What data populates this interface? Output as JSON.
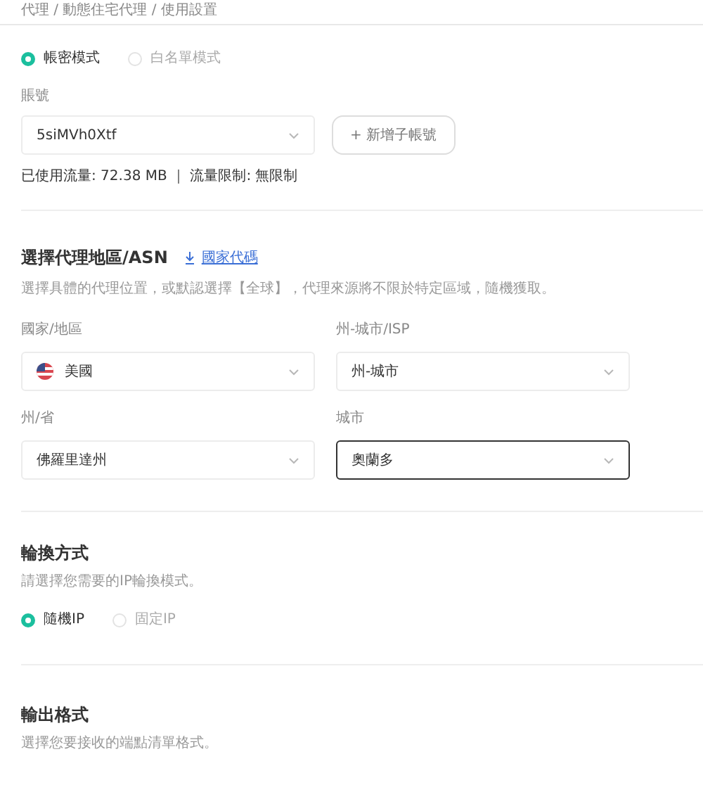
{
  "breadcrumb": "代理 / 動態住宅代理 / 使用設置",
  "auth_modes": [
    {
      "label": "帳密模式",
      "selected": true
    },
    {
      "label": "白名單模式",
      "selected": false
    }
  ],
  "account": {
    "label": "賬號",
    "value": "5siMVh0Xtf",
    "add_button": "+ 新增子帳號",
    "usage": "已使用流量: 72.38 MB ｜ 流量限制: 無限制"
  },
  "region": {
    "title": "選擇代理地區/ASN",
    "link": "國家代碼",
    "description": "選擇具體的代理位置，或默認選擇【全球】，代理來源將不限於特定區域，隨機獲取。",
    "fields": [
      {
        "label": "國家/地區",
        "value": "美國",
        "kind": "flag",
        "focused": false
      },
      {
        "label": "州-城市/ISP",
        "value": "州-城市",
        "kind": "plain",
        "focused": false
      },
      {
        "label": "州/省",
        "value": "佛羅里達州",
        "kind": "plain",
        "focused": false
      },
      {
        "label": "城市",
        "value": "奧蘭多",
        "kind": "plain",
        "focused": true
      }
    ]
  },
  "rotation": {
    "title": "輪換方式",
    "description": "請選擇您需要的IP輪換模式。",
    "options": [
      {
        "label": "隨機IP",
        "selected": true
      },
      {
        "label": "固定IP",
        "selected": false
      }
    ]
  },
  "output": {
    "title": "輸出格式",
    "description": "選擇您要接收的端點清單格式。"
  }
}
